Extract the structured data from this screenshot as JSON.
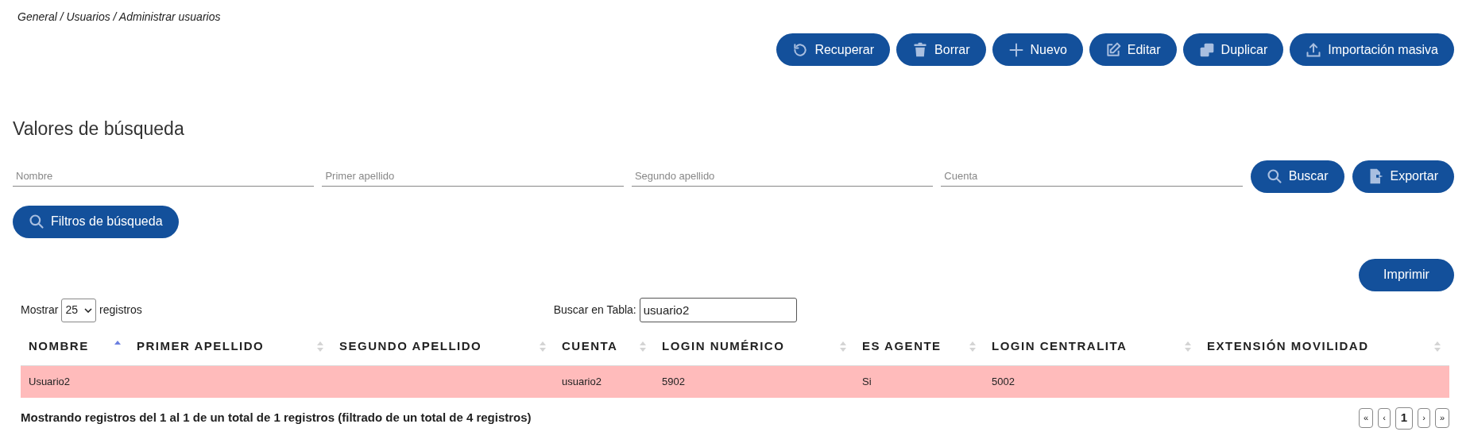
{
  "breadcrumb": "General / Usuarios / Administrar usuarios",
  "toolbar": [
    {
      "kind": "restore",
      "label": "Recuperar"
    },
    {
      "kind": "delete",
      "label": "Borrar"
    },
    {
      "kind": "new",
      "label": "Nuevo"
    },
    {
      "kind": "edit",
      "label": "Editar"
    },
    {
      "kind": "duplicate",
      "label": "Duplicar"
    },
    {
      "kind": "upload",
      "label": "Importación masiva"
    }
  ],
  "search": {
    "title": "Valores de búsqueda",
    "fields": [
      {
        "placeholder": "Nombre"
      },
      {
        "placeholder": "Primer apellido"
      },
      {
        "placeholder": "Segundo apellido"
      },
      {
        "placeholder": "Cuenta"
      }
    ],
    "buttons": [
      {
        "kind": "search",
        "label": "Buscar"
      },
      {
        "kind": "export",
        "label": "Exportar"
      }
    ],
    "filters_button": "Filtros de búsqueda"
  },
  "print_button": "Imprimir",
  "length": {
    "before": "Mostrar",
    "value": "25",
    "after": "registros"
  },
  "table_search": {
    "label": "Buscar en Tabla:",
    "value": "usuario2"
  },
  "table": {
    "columns": [
      {
        "label": "NOMBRE",
        "sorted": true
      },
      {
        "label": "PRIMER APELLIDO",
        "sorted": false
      },
      {
        "label": "SEGUNDO APELLIDO",
        "sorted": false
      },
      {
        "label": "CUENTA",
        "sorted": false
      },
      {
        "label": "LOGIN NUMÉRICO",
        "sorted": false
      },
      {
        "label": "ES AGENTE",
        "sorted": false
      },
      {
        "label": "LOGIN CENTRALITA",
        "sorted": false
      },
      {
        "label": "EXTENSIÓN MOVILIDAD",
        "sorted": false
      }
    ],
    "rows": [
      {
        "selected": true,
        "cells": [
          "Usuario2",
          "",
          "",
          "usuario2",
          "5902",
          "Si",
          "5002",
          ""
        ]
      }
    ]
  },
  "info": "Mostrando registros del 1 al 1 de un total de 1 registros (filtrado de un total de 4 registros)",
  "pagination": [
    {
      "label": "«",
      "selected": false
    },
    {
      "label": "‹",
      "selected": false
    },
    {
      "label": "1",
      "selected": true
    },
    {
      "label": "›",
      "selected": false
    },
    {
      "label": "»",
      "selected": false
    }
  ]
}
